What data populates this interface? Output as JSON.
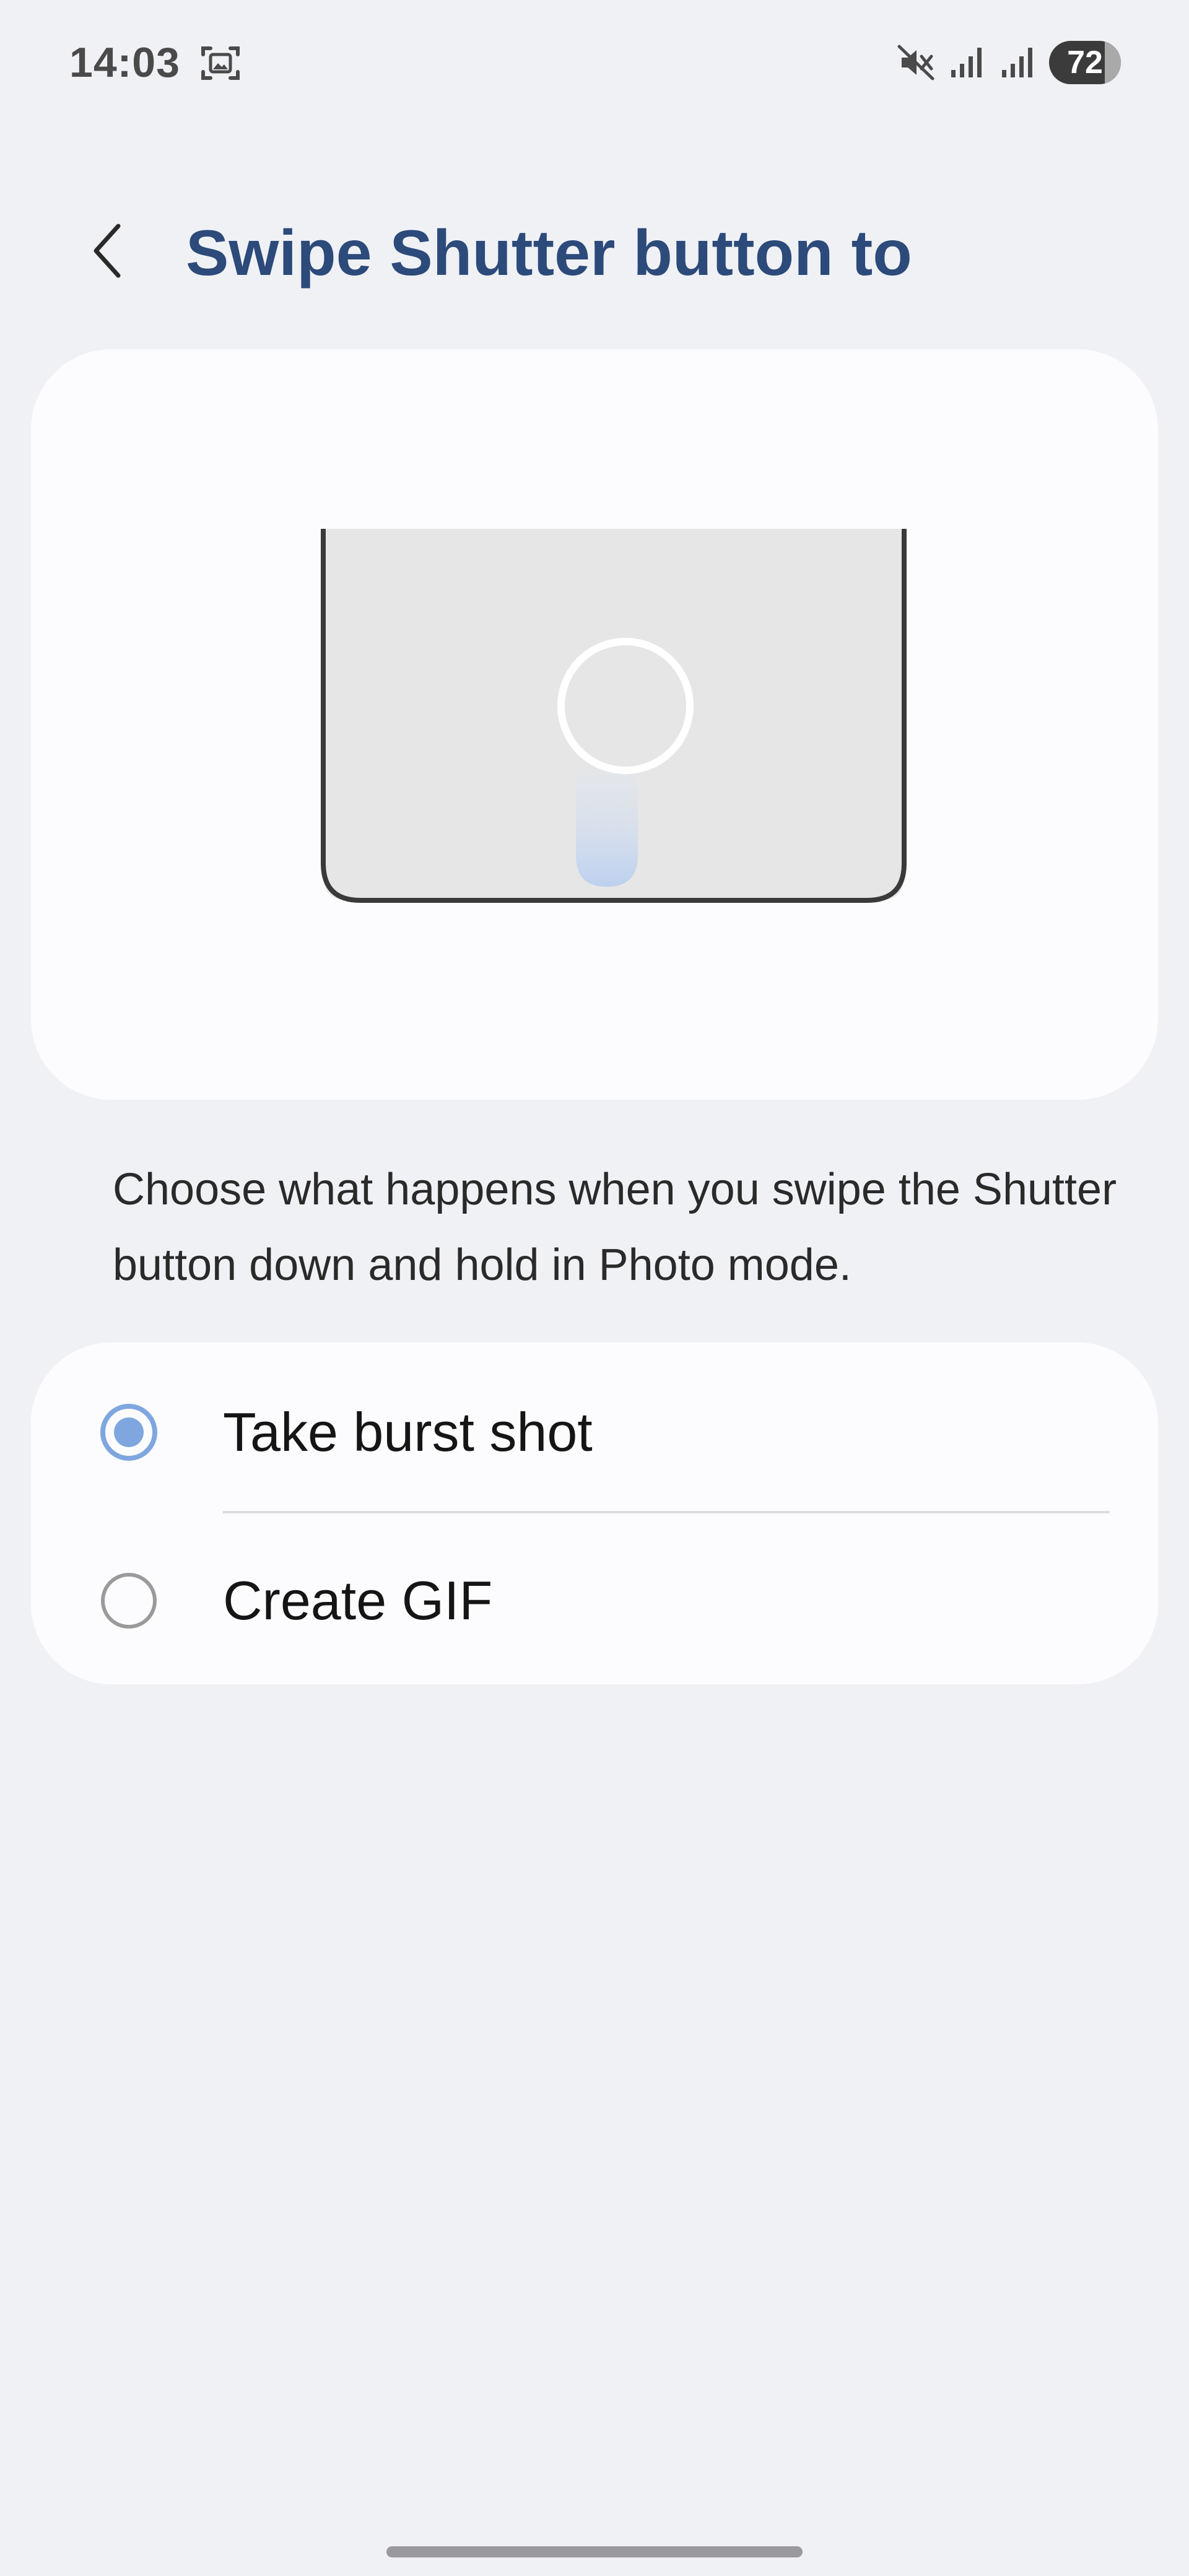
{
  "status_bar": {
    "time": "14:03",
    "battery": "72",
    "icons": [
      "screenshot-icon",
      "mute-icon",
      "signal-icon",
      "signal-icon"
    ]
  },
  "header": {
    "back_icon": "chevron-left-icon",
    "title": "Swipe Shutter button to"
  },
  "illustration": {
    "icon": "shutter-swipe-illustration"
  },
  "description": "Choose what happens when you swipe the Shutter button down and hold in Photo mode.",
  "options": [
    {
      "label": "Take burst shot",
      "selected": true
    },
    {
      "label": "Create GIF",
      "selected": false
    }
  ],
  "colors": {
    "title": "#2c4a7a",
    "accent": "#7fa6df",
    "background": "#f0f1f5",
    "card": "#fcfcfe"
  }
}
